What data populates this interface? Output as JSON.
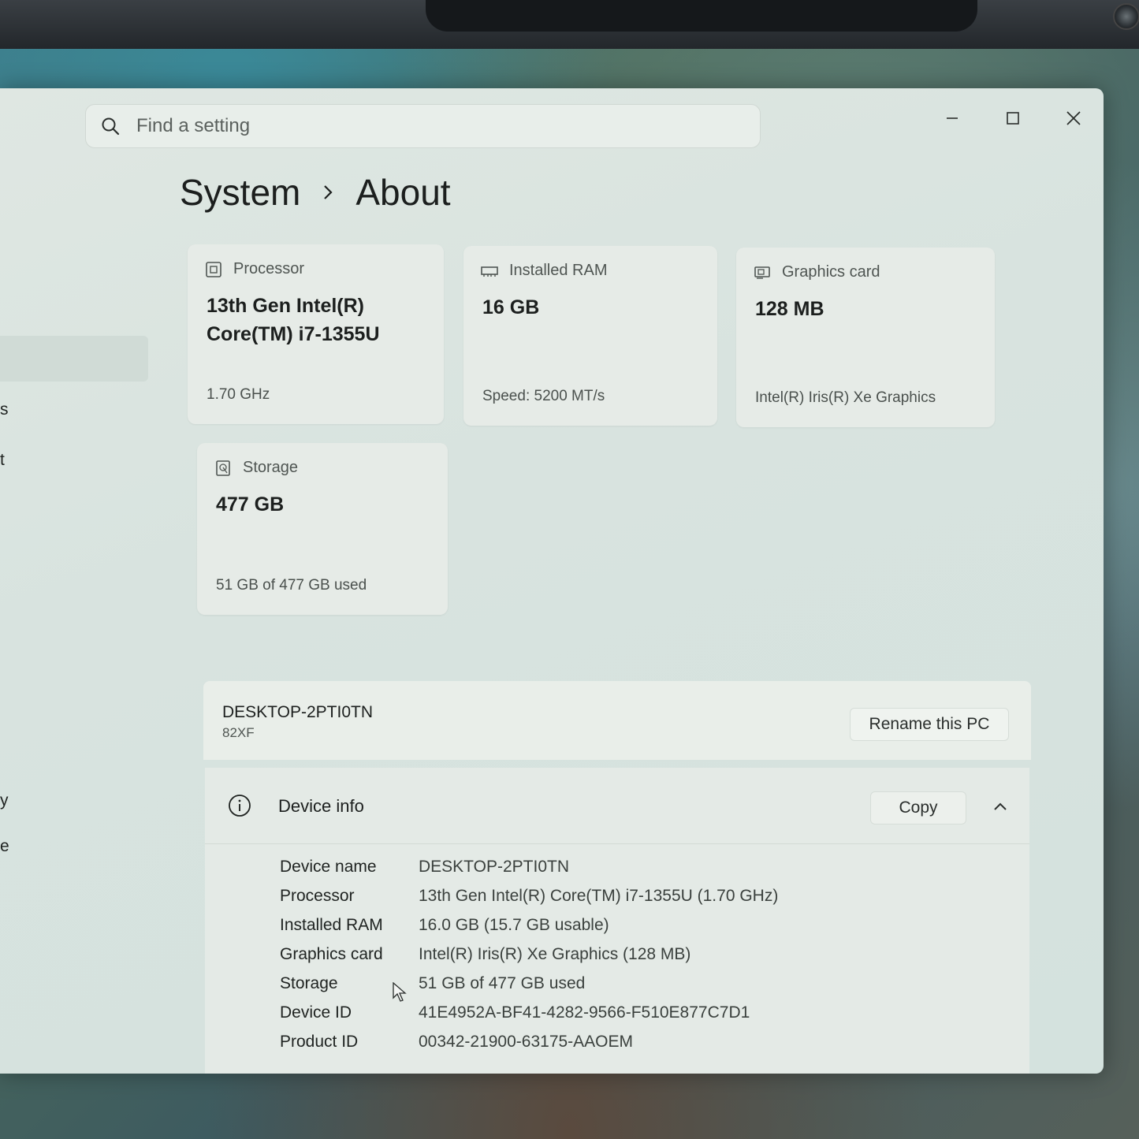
{
  "search": {
    "placeholder": "Find a setting"
  },
  "window_controls": {
    "minimize": "minimize-icon",
    "maximize": "maximize-icon",
    "close": "close-icon"
  },
  "breadcrumb": {
    "parent": "System",
    "current": "About"
  },
  "cards": {
    "processor": {
      "label": "Processor",
      "value": "13th Gen Intel(R) Core(TM) i7-1355U",
      "sub": "1.70 GHz",
      "icon": "processor-icon"
    },
    "ram": {
      "label": "Installed RAM",
      "value": "16 GB",
      "sub": "Speed: 5200 MT/s",
      "icon": "ram-icon"
    },
    "graphics": {
      "label": "Graphics card",
      "value": "128 MB",
      "sub": "Intel(R) Iris(R) Xe Graphics",
      "icon": "graphics-card-icon"
    },
    "storage": {
      "label": "Storage",
      "value": "477 GB",
      "sub": "51 GB of 477 GB used",
      "icon": "storage-icon"
    }
  },
  "pc": {
    "name": "DESKTOP-2PTI0TN",
    "model": "82XF",
    "rename_label": "Rename this PC"
  },
  "device_info": {
    "title": "Device info",
    "copy_label": "Copy",
    "rows": [
      {
        "label": "Device name",
        "value": "DESKTOP-2PTI0TN"
      },
      {
        "label": "Processor",
        "value": "13th Gen Intel(R) Core(TM) i7-1355U (1.70 GHz)"
      },
      {
        "label": "Installed RAM",
        "value": "16.0 GB (15.7 GB usable)"
      },
      {
        "label": "Graphics card",
        "value": "Intel(R) Iris(R) Xe Graphics (128 MB)"
      },
      {
        "label": "Storage",
        "value": "51 GB of 477 GB used"
      },
      {
        "label": "Device ID",
        "value": "41E4952A-BF41-4282-9566-F510E877C7D1"
      },
      {
        "label": "Product ID",
        "value": "00342-21900-63175-AAOEM"
      }
    ]
  },
  "sidebar_fragments": [
    "s",
    "t",
    "y",
    "e"
  ]
}
